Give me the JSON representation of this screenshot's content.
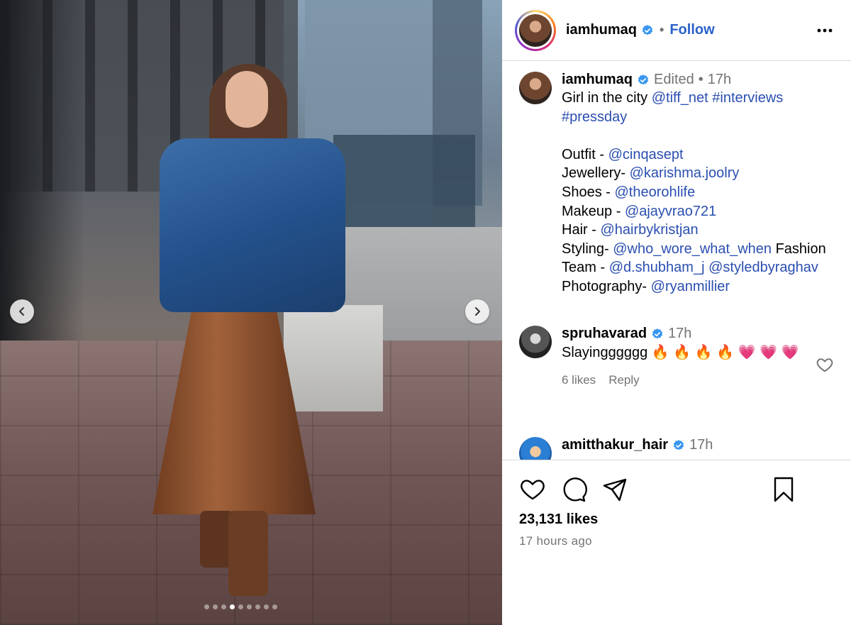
{
  "post": {
    "username": "iamhumaq",
    "follow_label": "Follow",
    "separator": "•"
  },
  "caption": {
    "username": "iamhumaq",
    "edited": "Edited",
    "dot": "•",
    "time": "17h",
    "segments": [
      {
        "t": "Girl in the city "
      },
      {
        "t": "@tiff_net",
        "link": true
      },
      {
        "t": " "
      },
      {
        "t": "#interviews",
        "link": true
      },
      {
        "t": "\n"
      },
      {
        "t": "#pressday",
        "link": true
      },
      {
        "t": "\n\n"
      },
      {
        "t": "Outfit - "
      },
      {
        "t": "@cinqasept",
        "link": true
      },
      {
        "t": "\n"
      },
      {
        "t": "Jewellery- "
      },
      {
        "t": "@karishma.joolry",
        "link": true
      },
      {
        "t": "\n"
      },
      {
        "t": "Shoes - "
      },
      {
        "t": "@theorohlife",
        "link": true
      },
      {
        "t": "\n"
      },
      {
        "t": "Makeup - "
      },
      {
        "t": "@ajayvrao721",
        "link": true
      },
      {
        "t": "\n"
      },
      {
        "t": "Hair - "
      },
      {
        "t": "@hairbykristjan",
        "link": true
      },
      {
        "t": "\n"
      },
      {
        "t": "Styling- "
      },
      {
        "t": "@who_wore_what_when",
        "link": true
      },
      {
        "t": " Fashion\n"
      },
      {
        "t": "Team - "
      },
      {
        "t": "@d.shubham_j",
        "link": true
      },
      {
        "t": " "
      },
      {
        "t": "@styledbyraghav",
        "link": true
      },
      {
        "t": "\n"
      },
      {
        "t": "Photography- "
      },
      {
        "t": "@ryanmillier",
        "link": true
      }
    ]
  },
  "comments": [
    {
      "username": "spruhavarad",
      "time": "17h",
      "text": "Slayingggggg 🔥 🔥 🔥 🔥 💗 💗 💗",
      "likes": "6 likes",
      "reply": "Reply"
    },
    {
      "username": "amitthakur_hair",
      "time": "17h"
    }
  ],
  "footer": {
    "likes": "23,131 likes",
    "time_ago": "17 hours ago"
  },
  "carousel": {
    "count": 9,
    "active_index": 3
  },
  "colors": {
    "link": "#2b4fb1",
    "follow": "#2b62c9",
    "verified": "#3897f0",
    "muted": "#737373",
    "border": "#dbdbdb"
  },
  "icons": [
    "chevron-left-icon",
    "chevron-right-icon",
    "verified-icon",
    "more-icon",
    "heart-icon",
    "comment-icon",
    "share-icon",
    "bookmark-icon"
  ]
}
